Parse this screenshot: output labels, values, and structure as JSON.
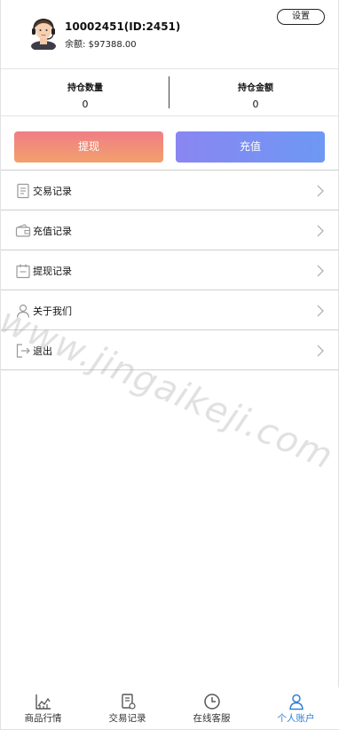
{
  "profile": {
    "user_id_text": "10002451(ID:2451)",
    "balance_label": "余额:",
    "balance_value": "$97388.00",
    "settings_label": "设置"
  },
  "holdings": {
    "quantity_label": "持仓数量",
    "quantity_value": "0",
    "amount_label": "持仓金额",
    "amount_value": "0"
  },
  "actions": {
    "withdraw_label": "提现",
    "deposit_label": "充值"
  },
  "menu": {
    "items": [
      {
        "label": "交易记录",
        "icon": "document-icon"
      },
      {
        "label": "充值记录",
        "icon": "wallet-icon"
      },
      {
        "label": "提现记录",
        "icon": "calendar-icon"
      },
      {
        "label": "关于我们",
        "icon": "person-icon"
      },
      {
        "label": "退出",
        "icon": "logout-icon"
      }
    ]
  },
  "watermark": "www.jingaikeji.com",
  "tabbar": {
    "tabs": [
      {
        "label": "商品行情",
        "icon": "chart-icon",
        "active": false
      },
      {
        "label": "交易记录",
        "icon": "receipt-icon",
        "active": false
      },
      {
        "label": "在线客服",
        "icon": "clock-icon",
        "active": false
      },
      {
        "label": "个人账户",
        "icon": "user-icon",
        "active": true
      }
    ]
  },
  "colors": {
    "withdraw_gradient": [
      "#f07d86",
      "#f2a06c"
    ],
    "deposit_gradient": [
      "#8a86f2",
      "#6d98f3"
    ],
    "active_tab": "#2f7fd8"
  }
}
